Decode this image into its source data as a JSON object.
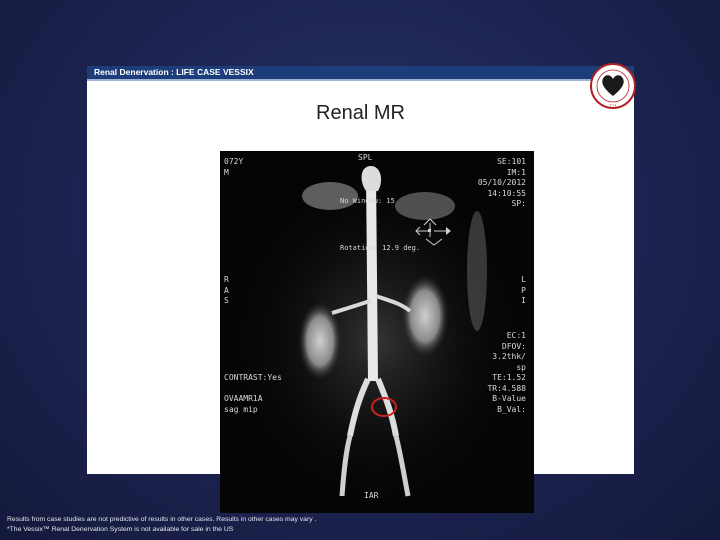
{
  "header": {
    "title": "Renal Denervation : LIFE CASE VESSIX"
  },
  "slide_title": "Renal MR",
  "logo": {
    "name": "heart-seal-logo"
  },
  "mri": {
    "top_center": "SPL",
    "top_left": [
      "072Y",
      "M"
    ],
    "top_right": [
      "SE:101",
      "IM:1",
      "05/10/2012",
      "14:10:55",
      "SP:"
    ],
    "window": "No Window: 15",
    "rotation": "Rotation: 12.9 deg.",
    "left_axis": [
      "R",
      "A",
      "S"
    ],
    "right_axis": [
      "L",
      "P",
      "I"
    ],
    "right_params": [
      "EC:1",
      "DFOV:",
      "3.2thk/",
      "sp",
      "TE:1.52",
      "TR:4.588",
      "B-Value",
      "B_Val:"
    ],
    "bottom_left": [
      "CONTRAST:Yes",
      "OVAAMR1A",
      "sag mip"
    ],
    "bottom_center": "IAR",
    "highlight_color": "#d22020"
  },
  "footer": {
    "line1": "Results from case studies are not predictive of results in other cases.  Results in other cases may vary .",
    "line2": "*The Vessix™ Renal Denervation System is not available for sale in the US"
  }
}
